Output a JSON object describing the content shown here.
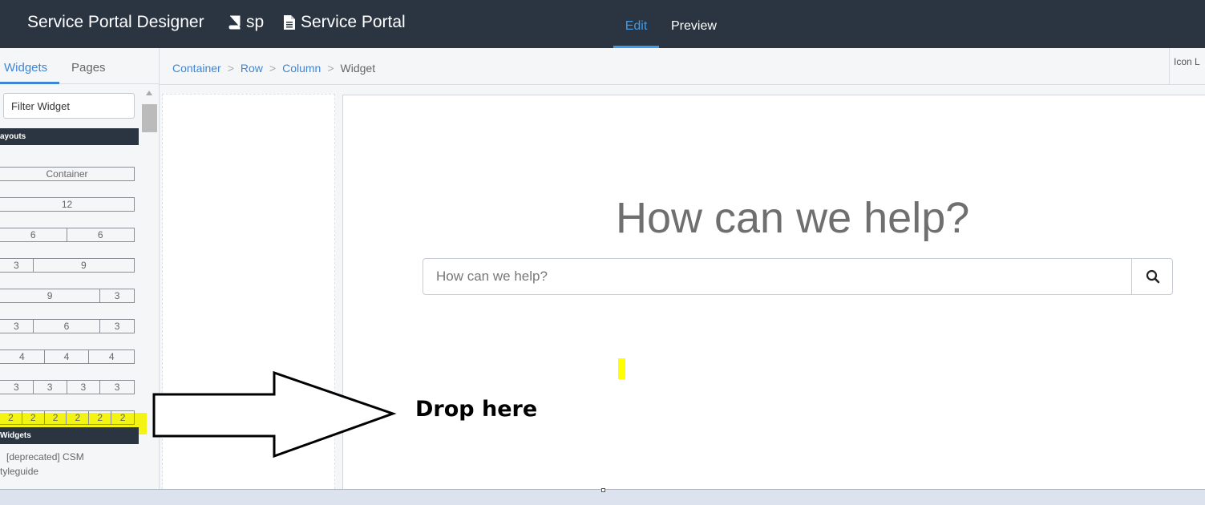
{
  "topbar": {
    "app_title": "Service Portal Designer",
    "portal_id": "sp",
    "portal_name": "Service Portal",
    "tabs": [
      {
        "label": "Edit",
        "active": true
      },
      {
        "label": "Preview",
        "active": false
      }
    ]
  },
  "left_panel": {
    "tabs": [
      {
        "label": "Widgets",
        "active": true
      },
      {
        "label": "Pages",
        "active": false
      }
    ],
    "filter_placeholder": "Filter Widget",
    "layouts_header": "ayouts",
    "container_label": "Container",
    "layouts": [
      [
        "12"
      ],
      [
        "6",
        "6"
      ],
      [
        "3",
        "9"
      ],
      [
        "9",
        "3"
      ],
      [
        "3",
        "6",
        "3"
      ],
      [
        "4",
        "4",
        "4"
      ],
      [
        "3",
        "3",
        "3",
        "3"
      ],
      [
        "2",
        "2",
        "2",
        "2",
        "2",
        "2"
      ]
    ],
    "widgets_header": "Widgets",
    "widget_items": [
      "[deprecated] CSM",
      "tyleguide"
    ]
  },
  "breadcrumb": {
    "items": [
      "Container",
      "Row",
      "Column"
    ],
    "current": "Widget",
    "separator": ">",
    "right_tab": "Icon L"
  },
  "canvas": {
    "headline": "How can we help?",
    "search_placeholder": "How can we help?"
  },
  "annotation": {
    "drop_label": "Drop here",
    "highlight_color": "#f4f414"
  },
  "colors": {
    "topbar_bg": "#2b3542",
    "accent": "#3d9be9",
    "link": "#3d86d6"
  }
}
